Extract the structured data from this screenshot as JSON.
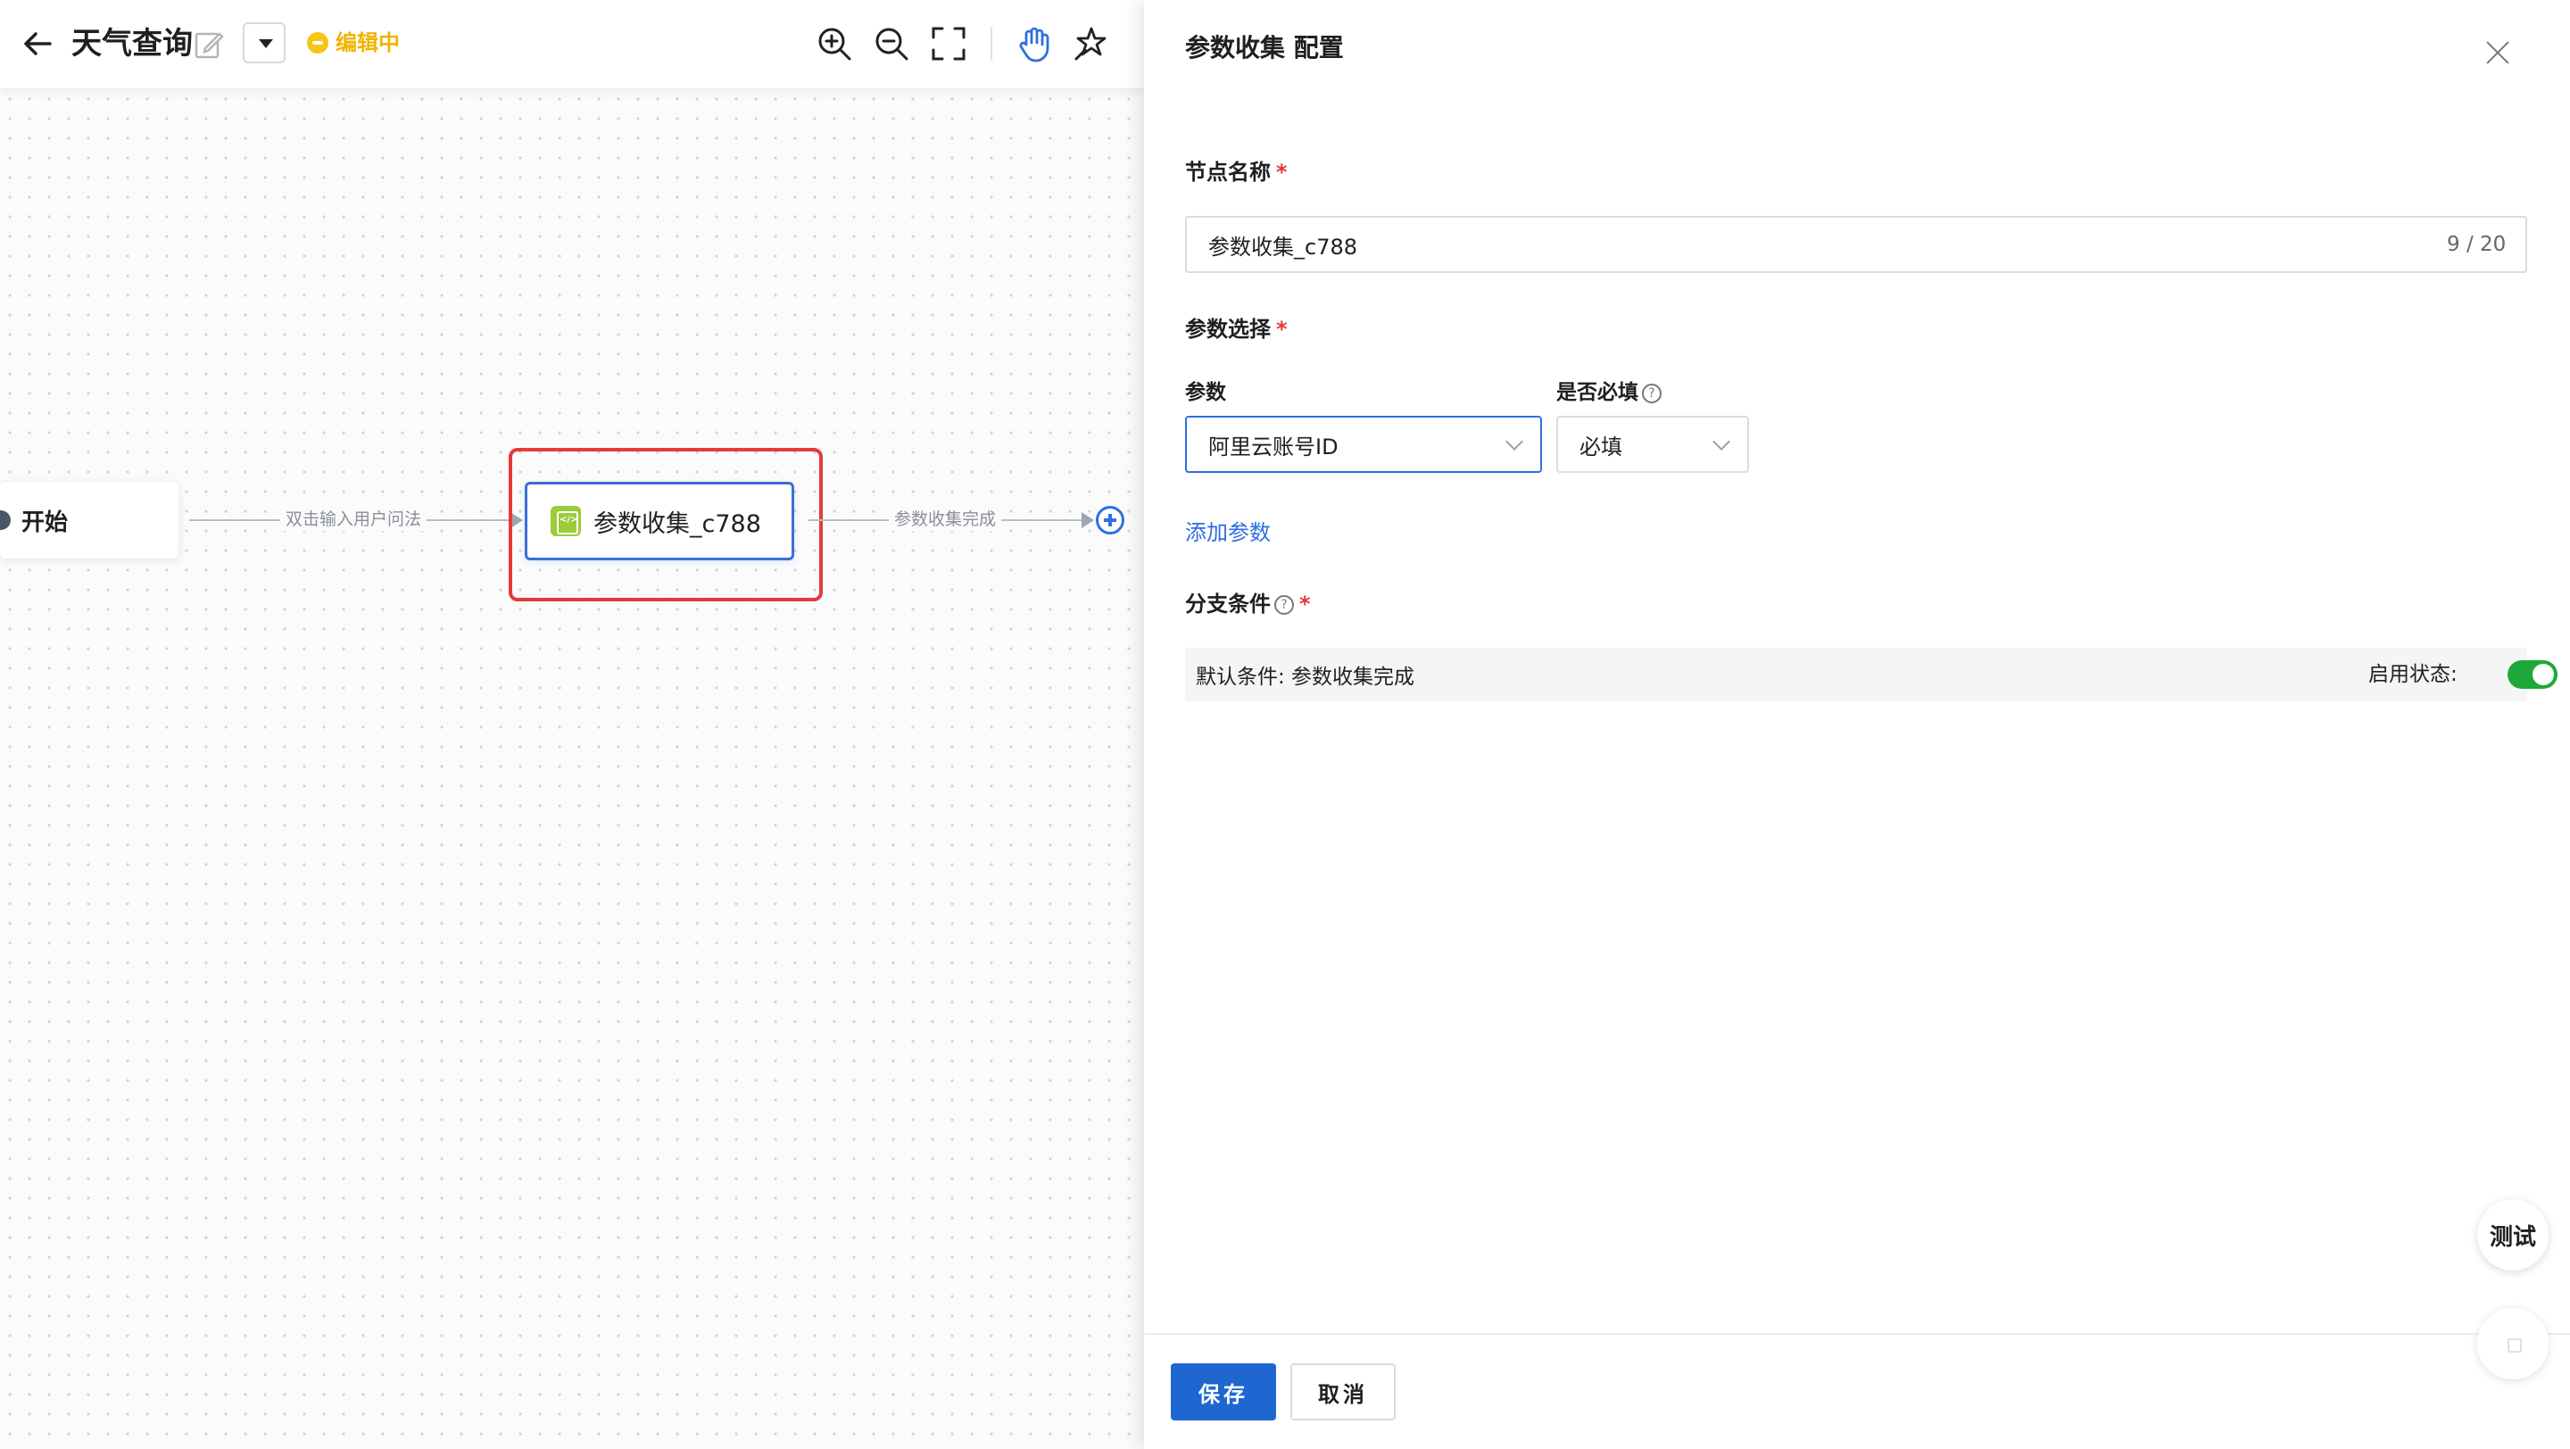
{
  "header": {
    "title": "天气查询",
    "status": "编辑中"
  },
  "flow": {
    "start_label": "开始",
    "edge1_label": "双击输入用户问法",
    "node_label": "参数收集_c788",
    "edge2_label": "参数收集完成"
  },
  "panel": {
    "title": "参数收集 配置",
    "node_name_label": "节点名称",
    "node_name_value": "参数收集_c788",
    "char_count": "9 / 20",
    "param_select_label": "参数选择",
    "param_col_label": "参数",
    "required_col_label": "是否必填",
    "param_value": "阿里云账号ID",
    "required_value": "必填",
    "add_param": "添加参数",
    "branch_label": "分支条件",
    "default_condition": "默认条件: 参数收集完成",
    "enable_label": "启用状态:",
    "enabled": true
  },
  "footer": {
    "save": "保存",
    "cancel": "取消"
  },
  "floating": {
    "test": "测试"
  },
  "colors": {
    "accent": "#1f66d1",
    "status": "#f0b400",
    "highlight": "#e63a3a",
    "toggle_on": "#1fa83a"
  }
}
